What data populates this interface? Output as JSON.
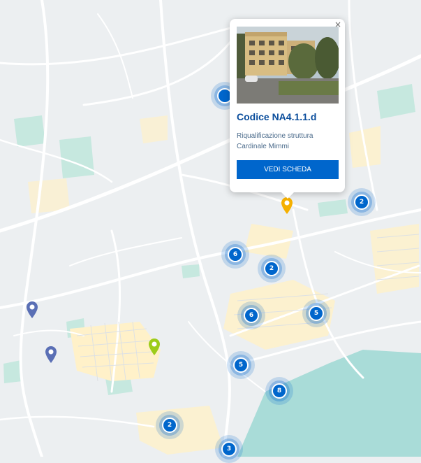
{
  "map": {
    "colors": {
      "land": "#eceff1",
      "water": "#a9dcd8",
      "green": "#c6e8df",
      "highlight": "#fff1c9",
      "road": "#ffffff",
      "cluster": "#0066cc"
    }
  },
  "clusters": [
    {
      "count": "2"
    },
    {
      "count": "6"
    },
    {
      "count": "2"
    },
    {
      "count": "6"
    },
    {
      "count": "5"
    },
    {
      "count": "5"
    },
    {
      "count": "8"
    },
    {
      "count": "2"
    },
    {
      "count": "3"
    }
  ],
  "pins": [
    {
      "color": "#f5b000",
      "icon": "map-pin-icon"
    },
    {
      "color": "#5a6fb5",
      "icon": "map-pin-icon"
    },
    {
      "color": "#5a6fb5",
      "icon": "map-pin-icon"
    },
    {
      "color": "#9ccc1a",
      "icon": "map-pin-icon"
    }
  ],
  "popup": {
    "code": "Codice NA4.1.1.d",
    "description": "Riqualificazione struttura Cardinale Mimmi",
    "button_label": "Vedi scheda",
    "close_symbol": "×"
  }
}
